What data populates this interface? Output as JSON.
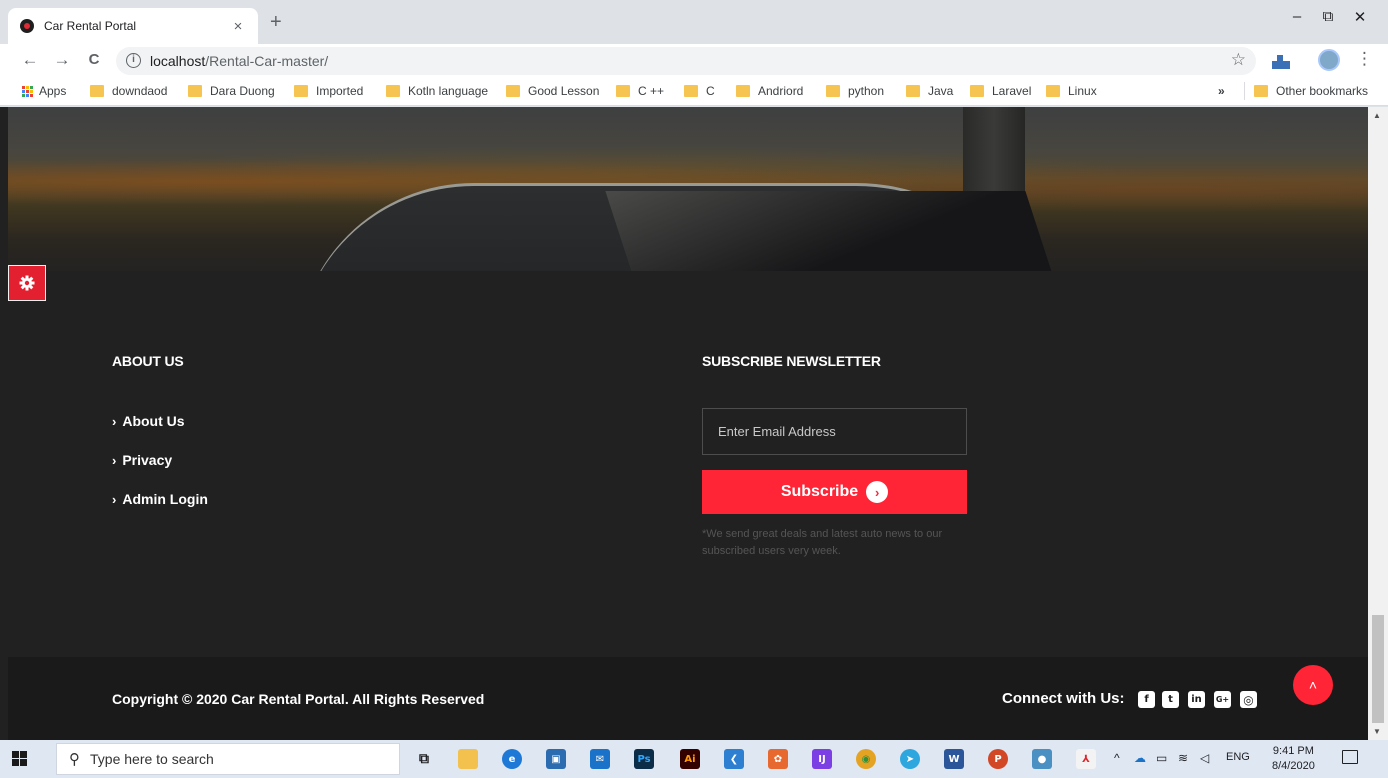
{
  "browser": {
    "tab_title": "Car Rental Portal",
    "close_glyph": "×",
    "new_tab_glyph": "+",
    "url_host": "localhost",
    "url_path": "/Rental-Car-master/",
    "back_glyph": "←",
    "forward_glyph": "→",
    "reload_glyph": "C",
    "info_glyph": "i",
    "star_glyph": "☆",
    "menu_glyph": "⋮",
    "minimize_glyph": "–",
    "restore_glyph": "⧉",
    "close_window_glyph": "✕"
  },
  "bookmarks": {
    "apps_label": "Apps",
    "items": [
      "downdaod",
      "Dara Duong",
      "Imported",
      "Kotln language",
      "Good Lesson",
      "C ++",
      "C",
      "Andriord",
      "python",
      "Java",
      "Laravel",
      "Linux"
    ],
    "overflow_glyph": "»",
    "other_label": "Other bookmarks"
  },
  "footer": {
    "about_heading": "ABOUT US",
    "links": [
      "About Us",
      "Privacy",
      "Admin Login"
    ],
    "link_chevron": "›",
    "newsletter_heading": "SUBSCRIBE NEWSLETTER",
    "email_placeholder": "Enter Email Address",
    "subscribe_label": "Subscribe",
    "subscribe_arrow": "›",
    "note": "*We send great deals and latest auto news to our subscribed users very week.",
    "copyright": "Copyright © 2020 Car Rental Portal. All Rights Reserved",
    "connect_label": "Connect with Us:",
    "social": [
      {
        "name": "facebook-icon",
        "glyph": "f"
      },
      {
        "name": "twitter-icon",
        "glyph": "t"
      },
      {
        "name": "linkedin-icon",
        "glyph": "in"
      },
      {
        "name": "google-plus-icon",
        "glyph": "G+"
      },
      {
        "name": "instagram-icon",
        "glyph": "◎"
      }
    ],
    "back_to_top_glyph": "˄"
  },
  "taskbar": {
    "search_placeholder": "Type here to search",
    "search_glyph": "⚲",
    "apps": [
      {
        "name": "task-view-icon",
        "glyph": "⧉",
        "color": "#dfe7f3",
        "fg": "#202124"
      },
      {
        "name": "file-explorer-icon",
        "glyph": "",
        "color": "#f2c14e",
        "fg": "#ffffff"
      },
      {
        "name": "edge-icon",
        "glyph": "e",
        "color": "#1e78d6",
        "fg": "#ffffff"
      },
      {
        "name": "store-icon",
        "glyph": "▣",
        "color": "#2b6cb0",
        "fg": "#ffffff"
      },
      {
        "name": "mail-icon",
        "glyph": "✉",
        "color": "#1a73c8",
        "fg": "#ffffff"
      },
      {
        "name": "photoshop-icon",
        "glyph": "Ps",
        "color": "#0c2d48",
        "fg": "#31a8ff"
      },
      {
        "name": "illustrator-icon",
        "glyph": "Ai",
        "color": "#330000",
        "fg": "#ff9a00"
      },
      {
        "name": "vscode-icon",
        "glyph": "❮",
        "color": "#2c7fd1",
        "fg": "#ffffff"
      },
      {
        "name": "postman-icon",
        "glyph": "✿",
        "color": "#e8692f",
        "fg": "#ffffff"
      },
      {
        "name": "intellij-icon",
        "glyph": "IJ",
        "color": "#7b3fe4",
        "fg": "#ffffff"
      },
      {
        "name": "chrome-icon",
        "glyph": "◉",
        "color": "#e5a323",
        "fg": "#2f8f3a"
      },
      {
        "name": "telegram-icon",
        "glyph": "➤",
        "color": "#2ea6de",
        "fg": "#ffffff"
      },
      {
        "name": "word-icon",
        "glyph": "W",
        "color": "#2b579a",
        "fg": "#ffffff"
      },
      {
        "name": "powerpoint-icon",
        "glyph": "P",
        "color": "#d24726",
        "fg": "#ffffff"
      },
      {
        "name": "chrome-profile-icon",
        "glyph": "●",
        "color": "#4a90c2",
        "fg": "#ffffff"
      },
      {
        "name": "acrobat-icon",
        "glyph": "⅄",
        "color": "#f3f3f3",
        "fg": "#e0242c"
      }
    ],
    "tray_chevron": "^",
    "language": "ENG",
    "time": "9:41 PM",
    "date": "8/4/2020"
  },
  "colors": {
    "accent_red": "#ff2536",
    "footer_bg": "#212121",
    "bottom_bar_bg": "#1a1a1a"
  }
}
